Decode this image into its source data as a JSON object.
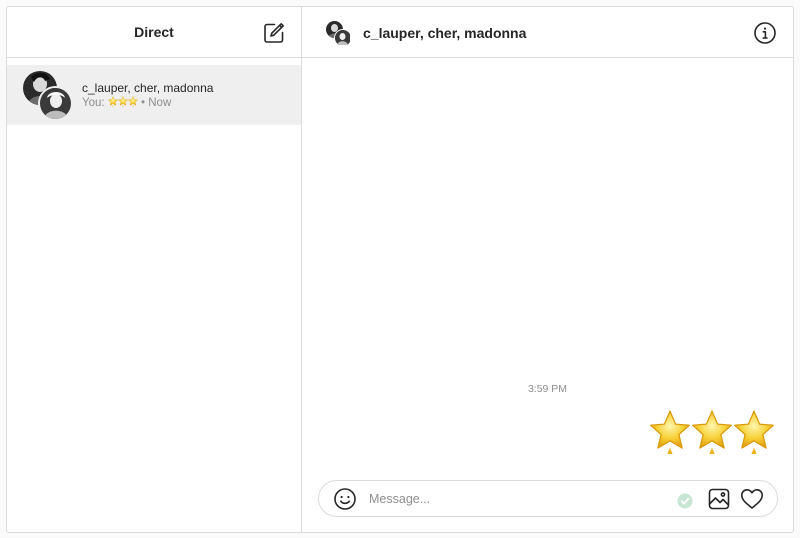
{
  "sidebar": {
    "title": "Direct",
    "compose_icon": "compose-icon",
    "threads": [
      {
        "name": "c_lauper, cher, madonna",
        "preview_prefix": "You:",
        "preview_emoji": [
          "star",
          "star",
          "star"
        ],
        "preview_suffix": "• Now",
        "active": true
      }
    ]
  },
  "chat": {
    "title": "c_lauper, cher, madonna",
    "info_icon": "info-icon",
    "timestamp": "3:59 PM",
    "message_emoji": [
      "star",
      "star",
      "star"
    ]
  },
  "composer": {
    "placeholder": "Message...",
    "emoji_icon": "smiley-icon",
    "image_icon": "image-icon",
    "like_icon": "heart-icon"
  },
  "colors": {
    "border": "#dbdbdb",
    "active_thread_bg": "#efefef",
    "muted_text": "#8e8e8e",
    "star_gold": "#f6c21c"
  }
}
